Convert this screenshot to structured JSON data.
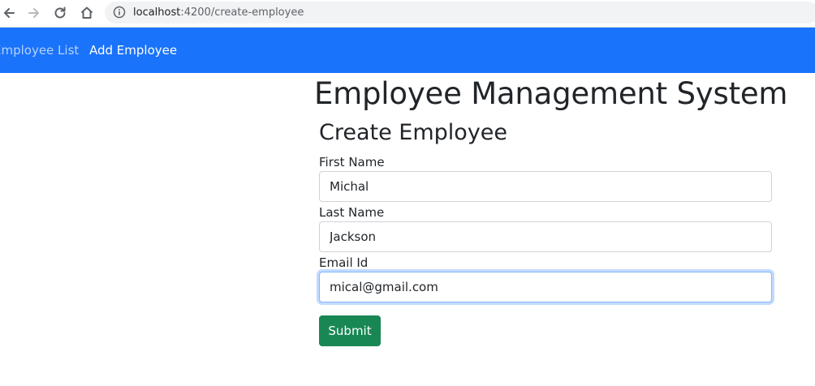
{
  "browser": {
    "url_host": "localhost",
    "url_path": ":4200/create-employee",
    "icons": [
      "back-icon",
      "forward-icon",
      "reload-icon",
      "home-icon",
      "info-icon"
    ]
  },
  "navbar": {
    "background": "#1a73fb",
    "items": [
      {
        "label": "Employee List",
        "active": false
      },
      {
        "label": "Add Employee",
        "active": true
      }
    ]
  },
  "page": {
    "title": "Employee Management System",
    "form_title": "Create Employee"
  },
  "form": {
    "first_name": {
      "label": "First Name",
      "value": "Michal"
    },
    "last_name": {
      "label": "Last Name",
      "value": "Jackson"
    },
    "email": {
      "label": "Email Id",
      "value": "mical@gmail.com",
      "focused": true
    },
    "submit_label": "Submit",
    "submit_color": "#198754"
  }
}
